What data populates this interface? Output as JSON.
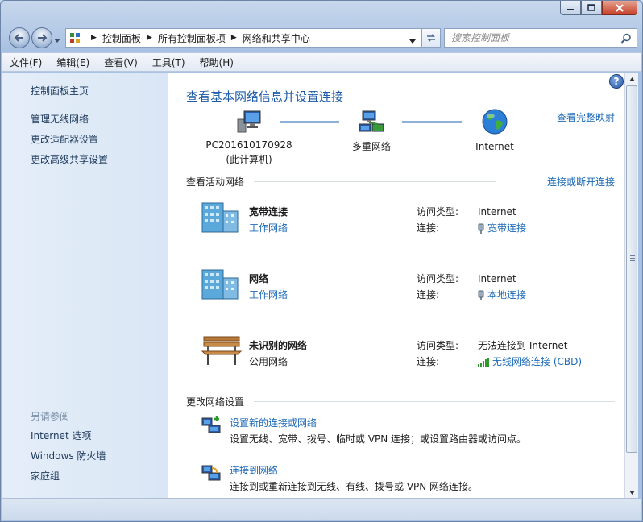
{
  "window": {
    "caption_buttons": [
      "minimize-icon",
      "maximize-icon",
      "close-icon"
    ]
  },
  "nav": {
    "breadcrumb": [
      "控制面板",
      "所有控制面板项",
      "网络和共享中心"
    ],
    "search_placeholder": "搜索控制面板"
  },
  "menu": {
    "items": [
      "文件(F)",
      "编辑(E)",
      "查看(V)",
      "工具(T)",
      "帮助(H)"
    ]
  },
  "sidebar": {
    "home": "控制面板主页",
    "links": [
      "管理无线网络",
      "更改适配器设置",
      "更改高级共享设置"
    ],
    "see_also_title": "另请参阅",
    "see_also": [
      "Internet 选项",
      "Windows 防火墙",
      "家庭组"
    ]
  },
  "main": {
    "help_label": "?",
    "title": "查看基本网络信息并设置连接",
    "full_map_link": "查看完整映射",
    "map": {
      "computer_name": "PC201610170928",
      "computer_note": "(此计算机)",
      "middle": "多重网络",
      "internet": "Internet"
    },
    "active_header": "查看活动网络",
    "connect_link": "连接或断开连接",
    "access_label": "访问类型:",
    "conn_label": "连接:",
    "networks": [
      {
        "name": "宽带连接",
        "type": "工作网络",
        "access": "Internet",
        "connection": "宽带连接",
        "icon": "office-building-icon"
      },
      {
        "name": "网络",
        "type": "工作网络",
        "access": "Internet",
        "connection": "本地连接",
        "icon": "office-building-icon"
      },
      {
        "name": "未识别的网络",
        "type": "公用网络",
        "access": "无法连接到 Internet",
        "connection": "无线网络连接 (CBD)",
        "icon": "park-bench-icon"
      }
    ],
    "change_header": "更改网络设置",
    "tasks": [
      {
        "link": "设置新的连接或网络",
        "desc": "设置无线、宽带、拨号、临时或 VPN 连接；或设置路由器或访问点。"
      },
      {
        "link": "连接到网络",
        "desc": "连接到或重新连接到无线、有线、拨号或 VPN 网络连接。"
      }
    ]
  },
  "colors": {
    "link": "#1e6ab7",
    "title": "#1d5aa8",
    "sidebar_bg": "#dfeaf7"
  }
}
